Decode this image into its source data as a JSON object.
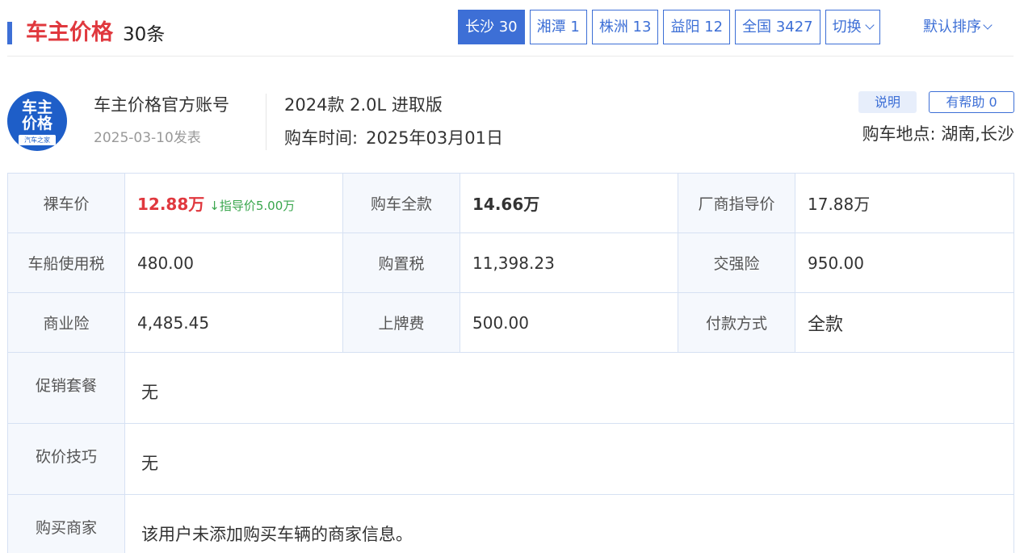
{
  "header": {
    "title": "车主价格",
    "count": "30条",
    "city_tabs": [
      {
        "label": "长沙 30",
        "active": true
      },
      {
        "label": "湘潭 1",
        "active": false
      },
      {
        "label": "株洲 13",
        "active": false
      },
      {
        "label": "益阳 12",
        "active": false
      },
      {
        "label": "全国 3427",
        "active": false
      }
    ],
    "switch_label": "切换",
    "sort_label": "默认排序"
  },
  "post": {
    "avatar_text": "车主价格",
    "avatar_sub": "汽车之家",
    "author": "车主价格官方账号",
    "date": "2025-03-10发表",
    "model": "2024款 2.0L 进取版",
    "buy_time_label": "购车时间:",
    "buy_time_value": "2025年03月01日",
    "explain_label": "说明",
    "helpful_label": "有帮助 0",
    "buy_place": "购车地点: 湖南,长沙"
  },
  "table": {
    "bare_price_label": "裸车价",
    "bare_price_value": "12.88万",
    "guide_drop": "↓指导价5.00万",
    "full_price_label": "购车全款",
    "full_price_value": "14.66万",
    "msrp_label": "厂商指导价",
    "msrp_value": "17.88万",
    "vessel_tax_label": "车船使用税",
    "vessel_tax_value": "480.00",
    "purchase_tax_label": "购置税",
    "purchase_tax_value": "11,398.23",
    "compulsory_ins_label": "交强险",
    "compulsory_ins_value": "950.00",
    "commercial_ins_label": "商业险",
    "commercial_ins_value": "4,485.45",
    "plate_fee_label": "上牌费",
    "plate_fee_value": "500.00",
    "payment_label": "付款方式",
    "payment_value": "全款",
    "promo_label": "促销套餐",
    "promo_value": "无",
    "bargain_label": "砍价技巧",
    "bargain_value": "无",
    "dealer_label": "购买商家",
    "dealer_value": "该用户未添加购买车辆的商家信息。"
  },
  "colors": {
    "accent": "#3d6fd6",
    "price_red": "#e0383e",
    "drop_green": "#3aa64d"
  }
}
